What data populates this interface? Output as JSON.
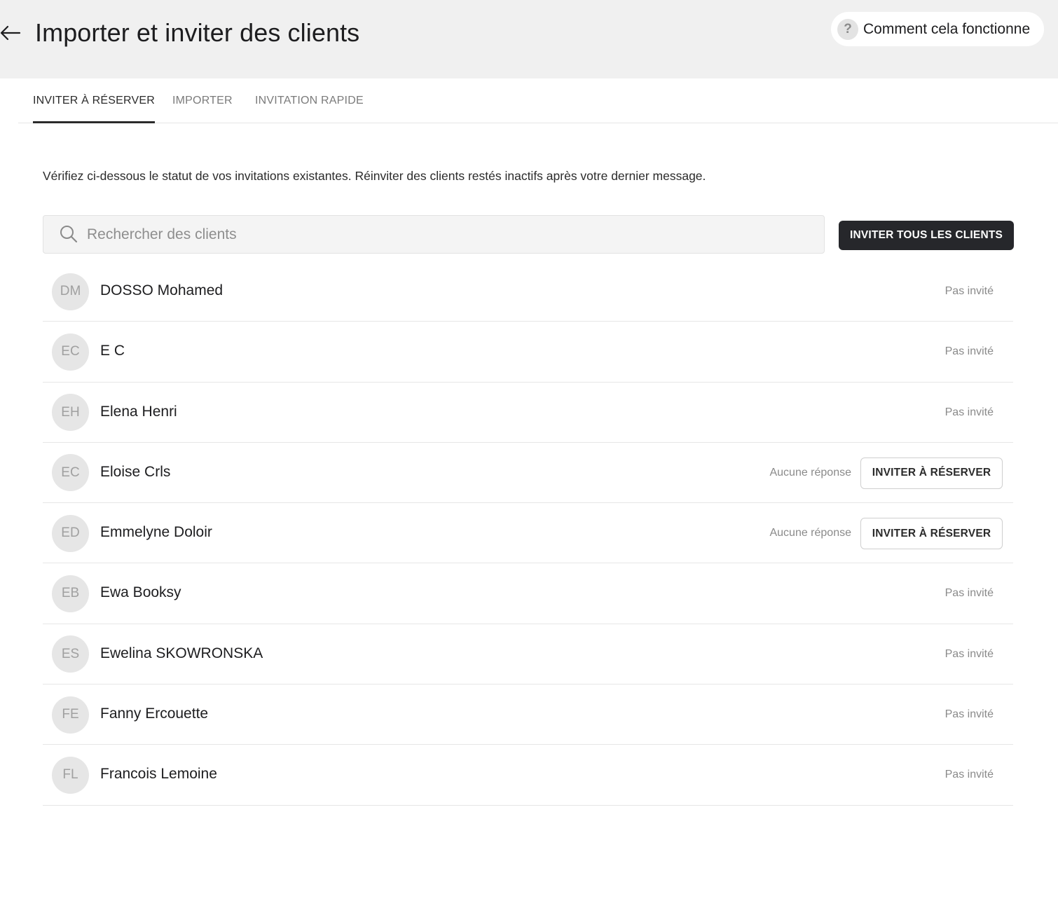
{
  "header": {
    "title": "Importer et inviter des clients",
    "help_label": "Comment cela fonctionne",
    "help_icon_glyph": "?"
  },
  "tabs": [
    {
      "label": "INVITER À RÉSERVER",
      "active": true
    },
    {
      "label": "IMPORTER",
      "active": false
    },
    {
      "label": "INVITATION RAPIDE",
      "active": false
    }
  ],
  "intro": "Vérifiez ci-dessous le statut de vos invitations existantes. Réinviter des clients restés inactifs après votre dernier message.",
  "search": {
    "placeholder": "Rechercher des clients",
    "value": ""
  },
  "invite_all_label": "INVITER TOUS LES CLIENTS",
  "clients": [
    {
      "initials": "DM",
      "name": "DOSSO Mohamed",
      "status": "Pas invité",
      "button": ""
    },
    {
      "initials": "EC",
      "name": "E C",
      "status": "Pas invité",
      "button": ""
    },
    {
      "initials": "EH",
      "name": "Elena Henri",
      "status": "Pas invité",
      "button": ""
    },
    {
      "initials": "EC",
      "name": "Eloise Crls",
      "status": "Aucune réponse",
      "button": "INVITER À RÉSERVER"
    },
    {
      "initials": "ED",
      "name": "Emmelyne Doloir",
      "status": "Aucune réponse",
      "button": "INVITER À RÉSERVER"
    },
    {
      "initials": "EB",
      "name": "Ewa Booksy",
      "status": "Pas invité",
      "button": ""
    },
    {
      "initials": "ES",
      "name": "Ewelina SKOWRONSKA",
      "status": "Pas invité",
      "button": ""
    },
    {
      "initials": "FE",
      "name": "Fanny Ercouette",
      "status": "Pas invité",
      "button": ""
    },
    {
      "initials": "FL",
      "name": "Francois Lemoine",
      "status": "Pas invité",
      "button": ""
    }
  ],
  "colors": {
    "header_bg": "#f0f0f0",
    "primary_button": "#26272b",
    "avatar_bg": "#e6e6e6",
    "status_text": "#8a8a8a"
  }
}
